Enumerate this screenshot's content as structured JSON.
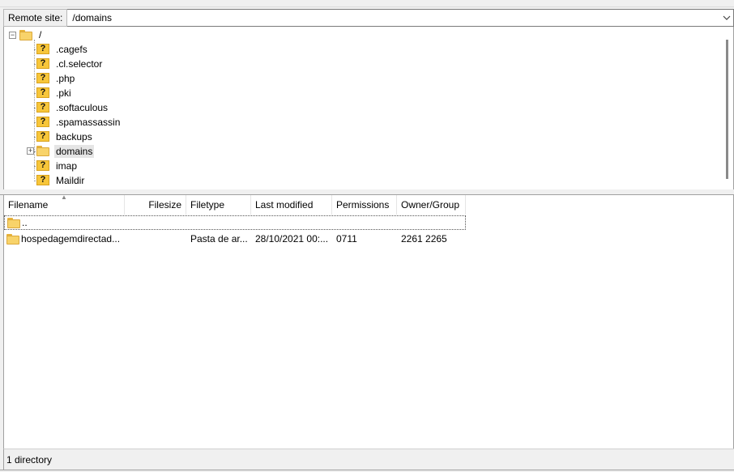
{
  "remote_bar": {
    "label": "Remote site:",
    "path": "/domains"
  },
  "tree": {
    "root": "/",
    "items": [
      {
        "label": ".cagefs",
        "icon": "unknown-folder-icon"
      },
      {
        "label": ".cl.selector",
        "icon": "unknown-folder-icon"
      },
      {
        "label": ".php",
        "icon": "unknown-folder-icon"
      },
      {
        "label": ".pki",
        "icon": "unknown-folder-icon"
      },
      {
        "label": ".softaculous",
        "icon": "unknown-folder-icon"
      },
      {
        "label": ".spamassassin",
        "icon": "unknown-folder-icon"
      },
      {
        "label": "backups",
        "icon": "unknown-folder-icon"
      },
      {
        "label": "domains",
        "icon": "folder-icon",
        "selected": true
      },
      {
        "label": "imap",
        "icon": "unknown-folder-icon"
      },
      {
        "label": "Maildir",
        "icon": "unknown-folder-icon"
      }
    ]
  },
  "file_list": {
    "columns": {
      "filename": "Filename",
      "filesize": "Filesize",
      "filetype": "Filetype",
      "last_modified": "Last modified",
      "permissions": "Permissions",
      "owner_group": "Owner/Group"
    },
    "rows": [
      {
        "filename": "..",
        "filesize": "",
        "filetype": "",
        "last_modified": "",
        "permissions": "",
        "owner_group": ""
      },
      {
        "filename": "hospedagemdirectad...",
        "filesize": "",
        "filetype": "Pasta de ar...",
        "last_modified": "28/10/2021 00:...",
        "permissions": "0711",
        "owner_group": "2261 2265"
      }
    ]
  },
  "status": {
    "text": "1 directory"
  },
  "colors": {
    "folder": "#f8d36a",
    "selection": "#e5e5e5"
  }
}
